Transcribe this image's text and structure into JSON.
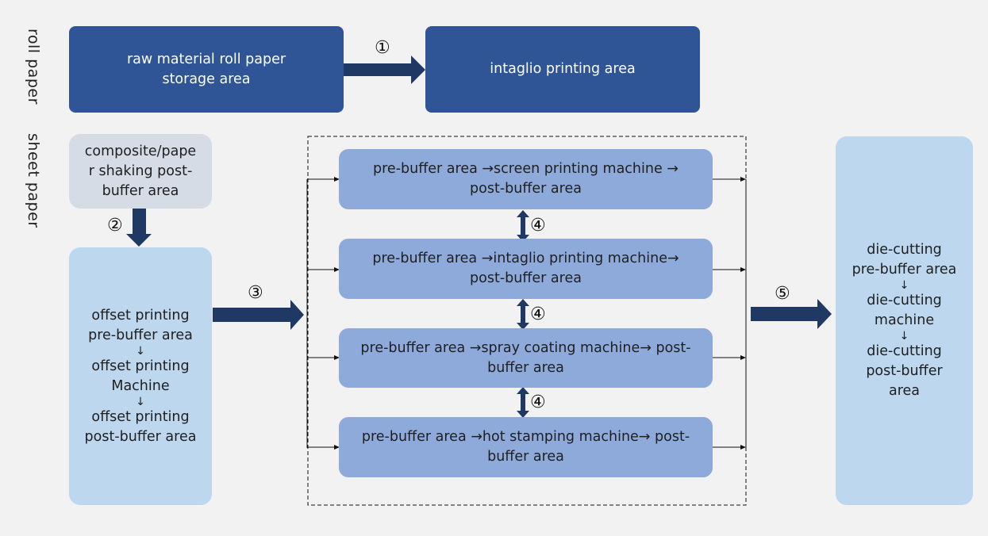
{
  "lanes": {
    "roll": "roll paper",
    "sheet": "sheet paper"
  },
  "boxes": {
    "raw_storage": [
      "raw material roll paper",
      "storage area"
    ],
    "intaglio_area": [
      "intaglio printing area"
    ],
    "composite": [
      "composite/pape",
      "r shaking post-",
      "buffer area"
    ],
    "offset": {
      "steps": [
        [
          "offset printing",
          "pre-buffer area"
        ],
        [
          "offset printing",
          "Machine"
        ],
        [
          "offset printing",
          "post-buffer area"
        ]
      ],
      "separator": "↓"
    },
    "screen": [
      "pre-buffer area →screen printing machine →",
      "post-buffer area"
    ],
    "intaglio_machine": [
      "pre-buffer area →intaglio printing machine→",
      "post-buffer area"
    ],
    "spray": [
      "pre-buffer area →spray coating machine→ post-",
      "buffer area"
    ],
    "hot_stamping": [
      "pre-buffer area →hot stamping machine→ post-",
      "buffer area"
    ],
    "die_cutting": {
      "steps": [
        [
          "die-cutting",
          "pre-buffer area"
        ],
        [
          "die-cutting",
          "machine"
        ],
        [
          "die-cutting",
          "post-buffer",
          "area"
        ]
      ],
      "separator": "↓"
    }
  },
  "flow_labels": {
    "step1": "①",
    "step2": "②",
    "step3": "③",
    "step4": "④",
    "step5": "⑤"
  },
  "colors": {
    "dark_box": "#2f5597",
    "arrow": "#203864",
    "grey_box": "#d6dce5",
    "light_box": "#bdd7ee",
    "mid_box": "#8eaadb",
    "background": "#f2f2f2"
  }
}
